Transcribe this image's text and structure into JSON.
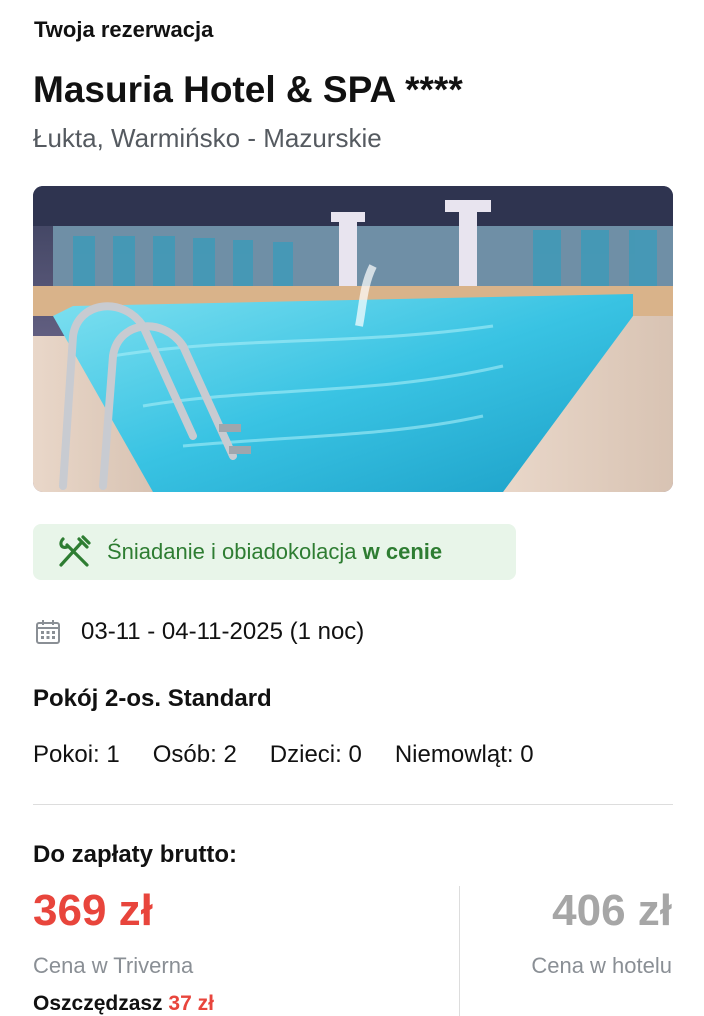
{
  "header": {
    "section_label": "Twoja rezerwacja"
  },
  "hotel": {
    "name": "Masuria Hotel & SPA ****",
    "location": "Łukta, Warmińsko - Mazurskie",
    "photo_icon": "hotel-pool-photo"
  },
  "board": {
    "icon": "cutlery-icon",
    "text_prefix": "Śniadanie i obiadokolacja ",
    "text_bold": "w cenie",
    "color": "#2e7d32",
    "background": "#e8f5e9"
  },
  "stay": {
    "icon": "calendar-icon",
    "dates": "03-11 - 04-11-2025 (1 noc)"
  },
  "room": {
    "name": "Pokój 2-os. Standard",
    "occupancy": [
      {
        "label": "Pokoi:",
        "value": "1"
      },
      {
        "label": "Osób:",
        "value": "2"
      },
      {
        "label": "Dzieci:",
        "value": "0"
      },
      {
        "label": "Niemowląt:",
        "value": "0"
      }
    ]
  },
  "payment": {
    "label": "Do zapłaty brutto:",
    "price": "369 zł",
    "price_caption": "Cena w Triverna",
    "savings_label": "Oszczędzasz ",
    "savings_amount": "37 zł",
    "hotel_price": "406 zł",
    "hotel_price_caption": "Cena w hotelu",
    "accent_color": "#e8453c"
  }
}
